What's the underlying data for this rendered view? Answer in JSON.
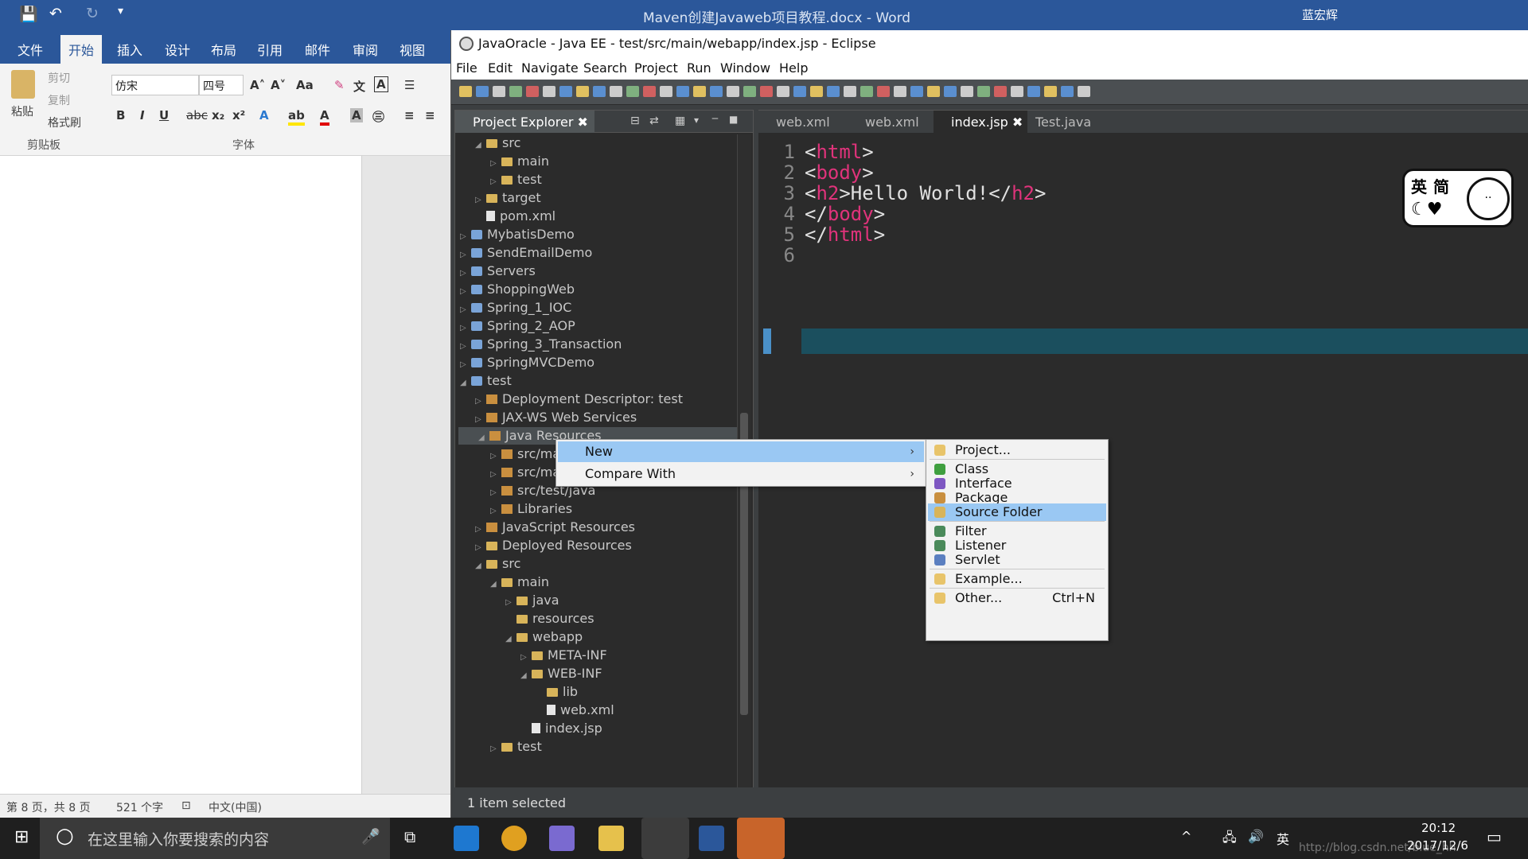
{
  "word": {
    "doc_title": "Maven创建Javaweb项目教程.docx - Word",
    "user": "蓝宏辉",
    "tabs": [
      "文件",
      "开始",
      "插入",
      "设计",
      "布局",
      "引用",
      "邮件",
      "审阅",
      "视图"
    ],
    "ribbon": {
      "paste": "粘贴",
      "cut": "剪切",
      "copy": "复制",
      "format_painter": "格式刷",
      "font_name": "仿宋",
      "font_size": "四号",
      "clipboard_group": "剪贴板",
      "font_group": "字体"
    },
    "status": {
      "page": "第 8 页，共 8 页",
      "words": "521 个字",
      "lang": "中文(中国)"
    }
  },
  "eclipse": {
    "title": "JavaOracle - Java EE - test/src/main/webapp/index.jsp - Eclipse",
    "menu": [
      "File",
      "Edit",
      "Navigate",
      "Search",
      "Project",
      "Run",
      "Window",
      "Help"
    ],
    "explorer_tab": "Project Explorer",
    "tree": [
      {
        "label": "src",
        "indent": 1,
        "tw": "◢",
        "icon": "folder"
      },
      {
        "label": "main",
        "indent": 2,
        "tw": "▷",
        "icon": "folder"
      },
      {
        "label": "test",
        "indent": 2,
        "tw": "▷",
        "icon": "folder"
      },
      {
        "label": "target",
        "indent": 1,
        "tw": "▷",
        "icon": "folder"
      },
      {
        "label": "pom.xml",
        "indent": 1,
        "tw": "",
        "icon": "doc"
      },
      {
        "label": "MybatisDemo",
        "indent": 0,
        "tw": "▷",
        "icon": "project"
      },
      {
        "label": "SendEmailDemo",
        "indent": 0,
        "tw": "▷",
        "icon": "project"
      },
      {
        "label": "Servers",
        "indent": 0,
        "tw": "▷",
        "icon": "project"
      },
      {
        "label": "ShoppingWeb",
        "indent": 0,
        "tw": "▷",
        "icon": "project"
      },
      {
        "label": "Spring_1_IOC",
        "indent": 0,
        "tw": "▷",
        "icon": "project"
      },
      {
        "label": "Spring_2_AOP",
        "indent": 0,
        "tw": "▷",
        "icon": "project"
      },
      {
        "label": "Spring_3_Transaction",
        "indent": 0,
        "tw": "▷",
        "icon": "project"
      },
      {
        "label": "SpringMVCDemo",
        "indent": 0,
        "tw": "▷",
        "icon": "project"
      },
      {
        "label": "test",
        "indent": 0,
        "tw": "◢",
        "icon": "project"
      },
      {
        "label": "Deployment Descriptor: test",
        "indent": 1,
        "tw": "▷",
        "icon": "jar"
      },
      {
        "label": "JAX-WS Web Services",
        "indent": 1,
        "tw": "▷",
        "icon": "jar"
      },
      {
        "label": "Java Resources",
        "indent": 1,
        "tw": "◢",
        "icon": "jar"
      },
      {
        "label": "src/ma",
        "indent": 2,
        "tw": "▷",
        "icon": "jar"
      },
      {
        "label": "src/ma",
        "indent": 2,
        "tw": "▷",
        "icon": "jar"
      },
      {
        "label": "src/test/java",
        "indent": 2,
        "tw": "▷",
        "icon": "jar"
      },
      {
        "label": "Libraries",
        "indent": 2,
        "tw": "▷",
        "icon": "jar"
      },
      {
        "label": "JavaScript Resources",
        "indent": 1,
        "tw": "▷",
        "icon": "jar"
      },
      {
        "label": "Deployed Resources",
        "indent": 1,
        "tw": "▷",
        "icon": "folder"
      },
      {
        "label": "src",
        "indent": 1,
        "tw": "◢",
        "icon": "folder"
      },
      {
        "label": "main",
        "indent": 2,
        "tw": "◢",
        "icon": "folder"
      },
      {
        "label": "java",
        "indent": 3,
        "tw": "▷",
        "icon": "folder"
      },
      {
        "label": "resources",
        "indent": 3,
        "tw": "",
        "icon": "folder"
      },
      {
        "label": "webapp",
        "indent": 3,
        "tw": "◢",
        "icon": "folder"
      },
      {
        "label": "META-INF",
        "indent": 4,
        "tw": "▷",
        "icon": "folder"
      },
      {
        "label": "WEB-INF",
        "indent": 4,
        "tw": "◢",
        "icon": "folder"
      },
      {
        "label": "lib",
        "indent": 5,
        "tw": "",
        "icon": "folder"
      },
      {
        "label": "web.xml",
        "indent": 5,
        "tw": "",
        "icon": "doc"
      },
      {
        "label": "index.jsp",
        "indent": 4,
        "tw": "",
        "icon": "doc"
      },
      {
        "label": "test",
        "indent": 2,
        "tw": "▷",
        "icon": "folder"
      }
    ],
    "editor_tabs": [
      "web.xml",
      "web.xml",
      "index.jsp",
      "Test.java"
    ],
    "active_tab": "index.jsp",
    "code_lines": [
      {
        "n": "1",
        "parts": [
          [
            "<",
            ""
          ],
          [
            "html",
            "tag"
          ],
          [
            ">",
            ""
          ]
        ]
      },
      {
        "n": "2",
        "parts": [
          [
            "<",
            ""
          ],
          [
            "body",
            "tag"
          ],
          [
            ">",
            ""
          ]
        ]
      },
      {
        "n": "3",
        "parts": [
          [
            "<",
            ""
          ],
          [
            "h2",
            "tag"
          ],
          [
            ">Hello World!</",
            ""
          ],
          [
            "h2",
            "tag"
          ],
          [
            ">",
            ""
          ]
        ]
      },
      {
        "n": "4",
        "parts": [
          [
            "</",
            ""
          ],
          [
            "body",
            "tag"
          ],
          [
            ">",
            ""
          ]
        ]
      },
      {
        "n": "5",
        "parts": [
          [
            "</",
            ""
          ],
          [
            "html",
            "tag"
          ],
          [
            ">",
            ""
          ]
        ]
      },
      {
        "n": "6",
        "parts": []
      }
    ],
    "status": "1 item selected"
  },
  "context_menu": {
    "items": [
      {
        "label": "New",
        "highlighted": true
      },
      {
        "label": "Compare With",
        "highlighted": false
      }
    ]
  },
  "submenu": {
    "items": [
      {
        "label": "Project...",
        "icon": "project-wizard-icon",
        "color": "#e8c46a"
      },
      {
        "label": "Class",
        "icon": "class-icon",
        "color": "#3f9f3f"
      },
      {
        "label": "Interface",
        "icon": "interface-icon",
        "color": "#7e57c2"
      },
      {
        "label": "Package",
        "icon": "package-icon",
        "color": "#c98f3f"
      },
      {
        "label": "Source Folder",
        "icon": "source-folder-icon",
        "color": "#d8b45a",
        "highlighted": true
      },
      {
        "label": "Filter",
        "icon": "filter-icon",
        "color": "#4a8a5a"
      },
      {
        "label": "Listener",
        "icon": "listener-icon",
        "color": "#4a8a5a"
      },
      {
        "label": "Servlet",
        "icon": "servlet-icon",
        "color": "#5b7fc0"
      },
      {
        "label": "Example...",
        "icon": "example-icon",
        "color": "#e8c46a"
      },
      {
        "label": "Other...",
        "icon": "other-icon",
        "color": "#e8c46a",
        "shortcut": "Ctrl+N"
      }
    ]
  },
  "sticker": {
    "text1": "英",
    "text2": "简"
  },
  "taskbar": {
    "search_placeholder": "在这里输入你要搜索的内容",
    "ime": "英",
    "time": "20:12",
    "date": "2017/12/6",
    "watermark": "http://blog.csdn.net/blue_hh"
  }
}
